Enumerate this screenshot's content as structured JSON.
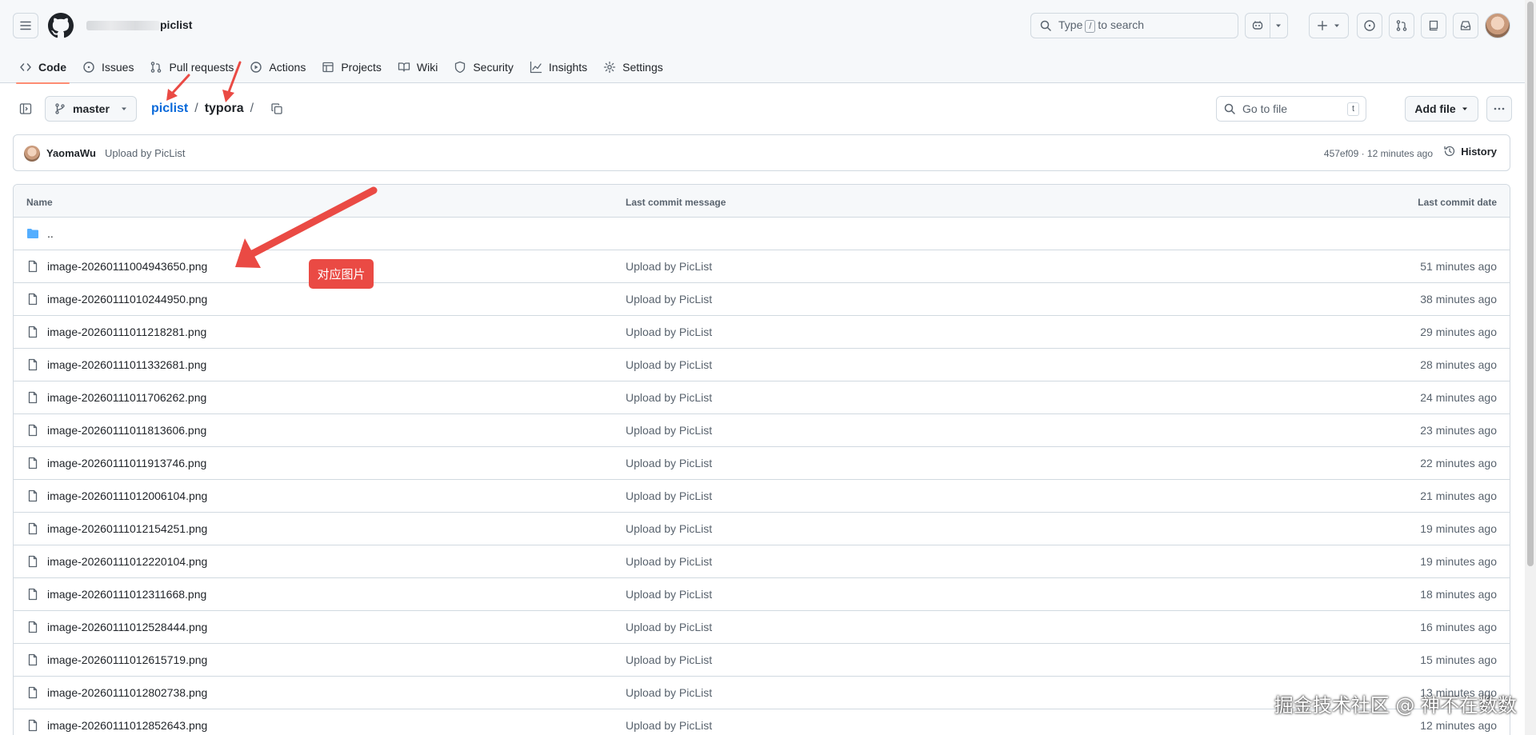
{
  "header": {
    "repo_name": "piclist",
    "search": {
      "before": "Type",
      "key": "/",
      "after": "to search"
    }
  },
  "tabs": [
    {
      "label": "Code",
      "icon": "code-icon",
      "active": true
    },
    {
      "label": "Issues",
      "icon": "issue-icon"
    },
    {
      "label": "Pull requests",
      "icon": "pull-request-icon"
    },
    {
      "label": "Actions",
      "icon": "play-icon"
    },
    {
      "label": "Projects",
      "icon": "table-icon"
    },
    {
      "label": "Wiki",
      "icon": "book-icon"
    },
    {
      "label": "Security",
      "icon": "shield-icon"
    },
    {
      "label": "Insights",
      "icon": "graph-icon"
    },
    {
      "label": "Settings",
      "icon": "gear-icon"
    }
  ],
  "pathbar": {
    "branch": "master",
    "crumb_repo": "piclist",
    "crumb_dir": "typora",
    "sep": "/",
    "goto_placeholder": "Go to file",
    "goto_key": "t",
    "add_file": "Add file"
  },
  "commit": {
    "author": "YaomaWu",
    "message": "Upload by PicList",
    "meta": "457ef09 · 12 minutes ago",
    "history": "History"
  },
  "table": {
    "headers": {
      "name": "Name",
      "message": "Last commit message",
      "date": "Last commit date"
    },
    "parent": "..",
    "rows": [
      {
        "name": "image-20260111004943650.png",
        "message": "Upload by PicList",
        "date": "51 minutes ago"
      },
      {
        "name": "image-20260111010244950.png",
        "message": "Upload by PicList",
        "date": "38 minutes ago"
      },
      {
        "name": "image-20260111011218281.png",
        "message": "Upload by PicList",
        "date": "29 minutes ago"
      },
      {
        "name": "image-20260111011332681.png",
        "message": "Upload by PicList",
        "date": "28 minutes ago"
      },
      {
        "name": "image-20260111011706262.png",
        "message": "Upload by PicList",
        "date": "24 minutes ago"
      },
      {
        "name": "image-20260111011813606.png",
        "message": "Upload by PicList",
        "date": "23 minutes ago"
      },
      {
        "name": "image-20260111011913746.png",
        "message": "Upload by PicList",
        "date": "22 minutes ago"
      },
      {
        "name": "image-20260111012006104.png",
        "message": "Upload by PicList",
        "date": "21 minutes ago"
      },
      {
        "name": "image-20260111012154251.png",
        "message": "Upload by PicList",
        "date": "19 minutes ago"
      },
      {
        "name": "image-20260111012220104.png",
        "message": "Upload by PicList",
        "date": "19 minutes ago"
      },
      {
        "name": "image-20260111012311668.png",
        "message": "Upload by PicList",
        "date": "18 minutes ago"
      },
      {
        "name": "image-20260111012528444.png",
        "message": "Upload by PicList",
        "date": "16 minutes ago"
      },
      {
        "name": "image-20260111012615719.png",
        "message": "Upload by PicList",
        "date": "15 minutes ago"
      },
      {
        "name": "image-20260111012802738.png",
        "message": "Upload by PicList",
        "date": "13 minutes ago"
      },
      {
        "name": "image-20260111012852643.png",
        "message": "Upload by PicList",
        "date": "12 minutes ago"
      }
    ]
  },
  "annotation": {
    "label": "对应图片",
    "color": "#ea4a44"
  },
  "watermark": "掘金技术社区 @ 神不在数数"
}
